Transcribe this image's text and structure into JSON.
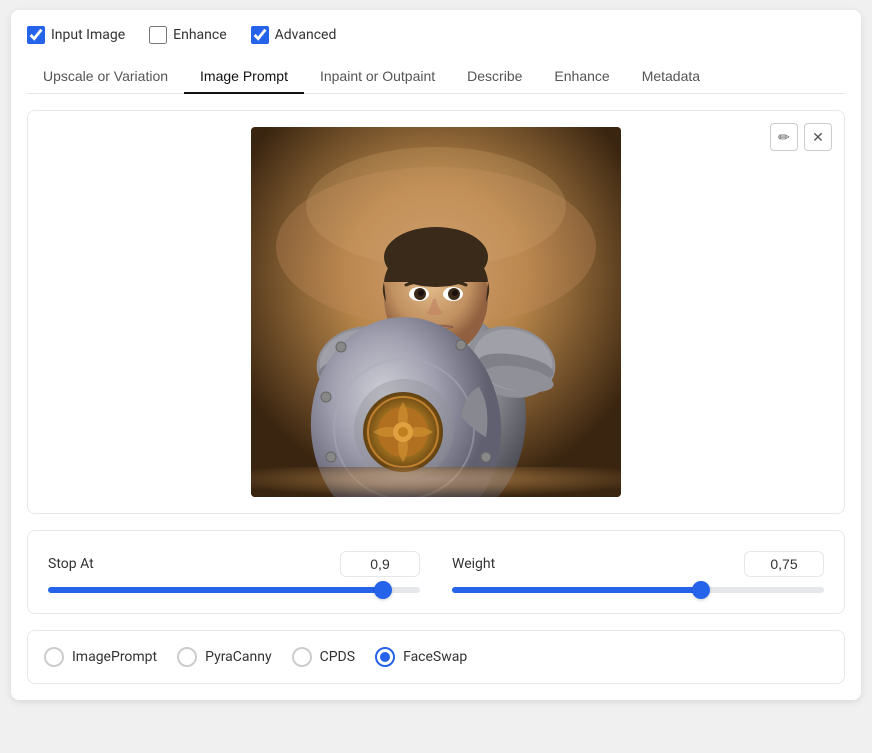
{
  "top": {
    "checkboxes": [
      {
        "id": "input-image",
        "label": "Input Image",
        "checked": true
      },
      {
        "id": "enhance",
        "label": "Enhance",
        "checked": false
      },
      {
        "id": "advanced",
        "label": "Advanced",
        "checked": true
      }
    ]
  },
  "tabs": [
    {
      "id": "upscale",
      "label": "Upscale or Variation",
      "active": false
    },
    {
      "id": "image-prompt",
      "label": "Image Prompt",
      "active": true
    },
    {
      "id": "inpaint",
      "label": "Inpaint or Outpaint",
      "active": false
    },
    {
      "id": "describe",
      "label": "Describe",
      "active": false
    },
    {
      "id": "enhance",
      "label": "Enhance",
      "active": false
    },
    {
      "id": "metadata",
      "label": "Metadata",
      "active": false
    }
  ],
  "image": {
    "edit_icon": "✏",
    "close_icon": "✕",
    "alt": "Knight in armor with shield"
  },
  "sliders": [
    {
      "id": "stop-at",
      "label": "Stop At",
      "value": "0,9",
      "fill_percent": 90,
      "thumb_percent": 90
    },
    {
      "id": "weight",
      "label": "Weight",
      "value": "0,75",
      "fill_percent": 67,
      "thumb_percent": 67
    }
  ],
  "radio_options": [
    {
      "id": "image-prompt-radio",
      "label": "ImagePrompt",
      "selected": false
    },
    {
      "id": "pyracanny-radio",
      "label": "PyraCanny",
      "selected": false
    },
    {
      "id": "cpds-radio",
      "label": "CPDS",
      "selected": false
    },
    {
      "id": "faceswap-radio",
      "label": "FaceSwap",
      "selected": true
    }
  ]
}
